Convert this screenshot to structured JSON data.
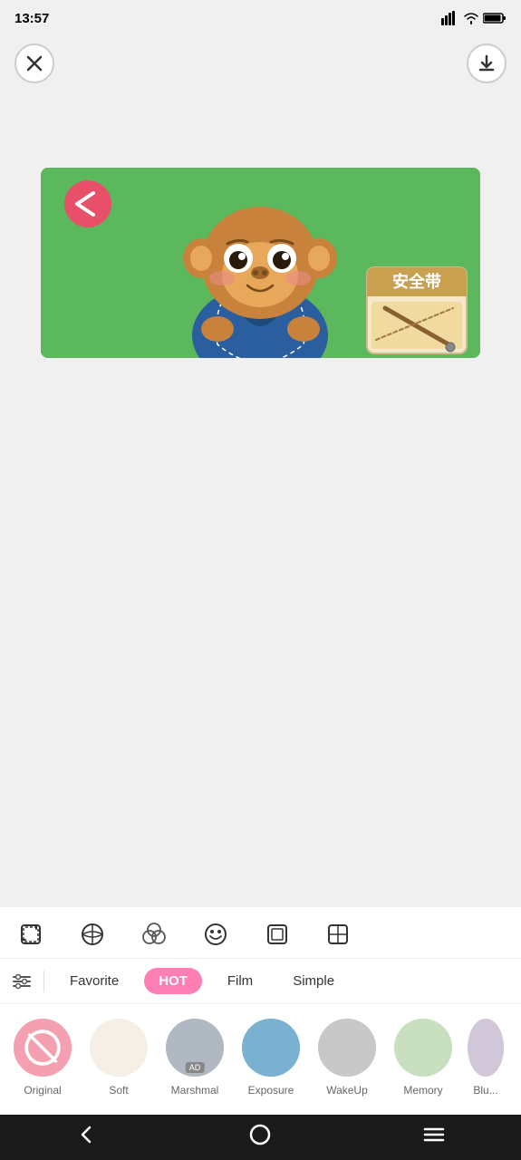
{
  "statusBar": {
    "time": "13:57",
    "icons": [
      "location",
      "compass",
      "mail",
      "notification",
      "dot"
    ]
  },
  "topBar": {
    "closeLabel": "×",
    "downloadLabel": "↓"
  },
  "tools": [
    {
      "name": "crop",
      "icon": "crop-icon"
    },
    {
      "name": "filter",
      "icon": "filter-icon"
    },
    {
      "name": "beauty",
      "icon": "beauty-icon"
    },
    {
      "name": "sticker",
      "icon": "sticker-icon"
    },
    {
      "name": "frame",
      "icon": "frame-icon"
    },
    {
      "name": "more",
      "icon": "more-icon"
    }
  ],
  "filterCategories": [
    {
      "id": "favorite",
      "label": "Favorite",
      "active": false
    },
    {
      "id": "hot",
      "label": "HOT",
      "active": true
    },
    {
      "id": "film",
      "label": "Film",
      "active": false
    },
    {
      "id": "simple",
      "label": "Simple",
      "active": false
    }
  ],
  "filters": [
    {
      "id": "original",
      "label": "Original",
      "type": "original"
    },
    {
      "id": "soft",
      "label": "Soft",
      "type": "soft"
    },
    {
      "id": "marshmal",
      "label": "Marshmal",
      "type": "marshmal",
      "hasAd": true
    },
    {
      "id": "exposure",
      "label": "Exposure",
      "type": "exposure"
    },
    {
      "id": "wakeup",
      "label": "WakeUp",
      "type": "wakeup"
    },
    {
      "id": "memory",
      "label": "Memory",
      "type": "memory"
    },
    {
      "id": "blur",
      "label": "Blu...",
      "type": "blur"
    }
  ],
  "nav": {
    "back": "‹",
    "home": "○",
    "menu": "≡"
  }
}
